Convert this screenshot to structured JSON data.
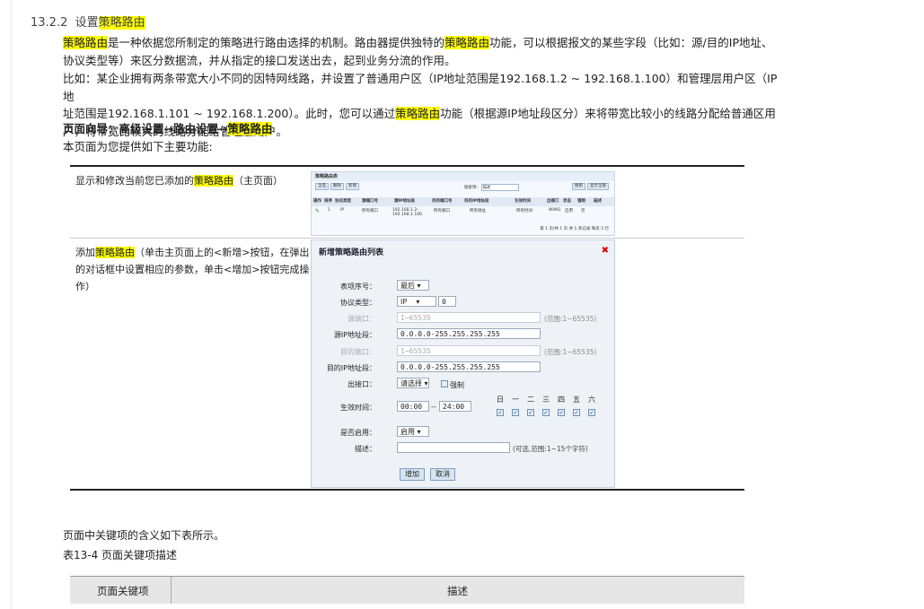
{
  "section": {
    "number": "13.2.2",
    "title_prefix": "设置",
    "title_hl": "策略路由"
  },
  "intro": {
    "p1_hl1": "策略路由",
    "p1_a": "是一种依据您所制定的策略进行路由选择的机制。路由器提供独特的",
    "p1_hl2": "策略路由",
    "p1_b": "功能，可以根据报文的某些字段（比如：源/目的IP地址、",
    "p1_c": "协议类型等）来区分数据流，并从指定的接口发送出去，起到业务分流的作用。",
    "p2_a": "比如：某企业拥有两条带宽大小不同的因特网线路，并设置了普通用户区（IP地址范围是192.168.1.2 ~ 192.168.1.100）和管理层用户区（IP地",
    "p2_b": "址范围是192.168.1.101 ~ 192.168.1.200）。此时，您可以通过",
    "p2_hl": "策略路由",
    "p2_c": "功能（根据源IP地址段区分）来将带宽比较小的线路分配给普通区用",
    "p2_d": "户，将带宽比较大的线路分配给管理层用户。",
    "nav_a": "页面向导：高级设置→路由设置→",
    "nav_hl": "策略路由",
    "p3": "本页面为您提供如下主要功能:"
  },
  "rows": [
    {
      "a": "显示和修改当前您已添加的",
      "hl": "策略路由",
      "b": "（主页面）"
    },
    {
      "a": "添加",
      "hl": "策略路由",
      "b": "（单击主页面上的<新增>按钮，在弹出",
      "c": "的对话框中设置相应的参数，单击<增加>按钮完成操",
      "d": "作）"
    }
  ],
  "shot1": {
    "title": "策略路由表",
    "buttons": [
      "全选",
      "删除",
      "新增"
    ],
    "search_label": "搜索项：",
    "search_value": "描述",
    "right_buttons": [
      "搜索",
      "显示全部"
    ],
    "headers": [
      "操作",
      "排序",
      "协议类型",
      "源端口号",
      "源IP地址段",
      "目的端口号",
      "目的IP地址段",
      "生效时间",
      "出接口",
      "状态",
      "强制",
      "描述"
    ],
    "row": [
      "1",
      "IP",
      "所有端口",
      "192.168.1.2-192.168.1.100",
      "所有端口",
      "所有地址",
      "所有时间",
      "WAN1",
      "启用",
      "否"
    ],
    "pager": "第 1 页/共 1 页 共 1 条记录 每页 5 行"
  },
  "shot2": {
    "title": "新增策略路由列表",
    "close": "✖",
    "fields": {
      "seq_label": "表项序号：",
      "seq_value": "最后",
      "proto_label": "协议类型：",
      "proto_value": "IP",
      "proto_num": "0",
      "sport_label": "源端口：",
      "sport_ph": "1~65535",
      "sport_hint": "(范围:1~65535)",
      "sip_label": "源IP地址段：",
      "sip_value": "0.0.0.0-255.255.255.255",
      "dport_label": "目的端口：",
      "dport_ph": "1~65535",
      "dport_hint": "(范围:1~65535)",
      "dip_label": "目的IP地址段：",
      "dip_value": "0.0.0.0-255.255.255.255",
      "out_label": "出接口：",
      "out_value": "请选择",
      "force_label": "强制",
      "time_label": "生效时间：",
      "time_start": "00:00",
      "time_sep": "--",
      "time_end": "24:00",
      "days": [
        "日",
        "一",
        "二",
        "三",
        "四",
        "五",
        "六"
      ],
      "enable_label": "是否启用：",
      "enable_value": "启用",
      "desc_label": "描述：",
      "desc_hint": "(可选,范围:1~15个字符)"
    },
    "add_button": "增加",
    "cancel_button": "取消"
  },
  "after": {
    "p1": "页面中关键项的含义如下表所示。",
    "caption": "表13-4 页面关键项描述",
    "col1": "页面关键项",
    "col2": "描述"
  }
}
